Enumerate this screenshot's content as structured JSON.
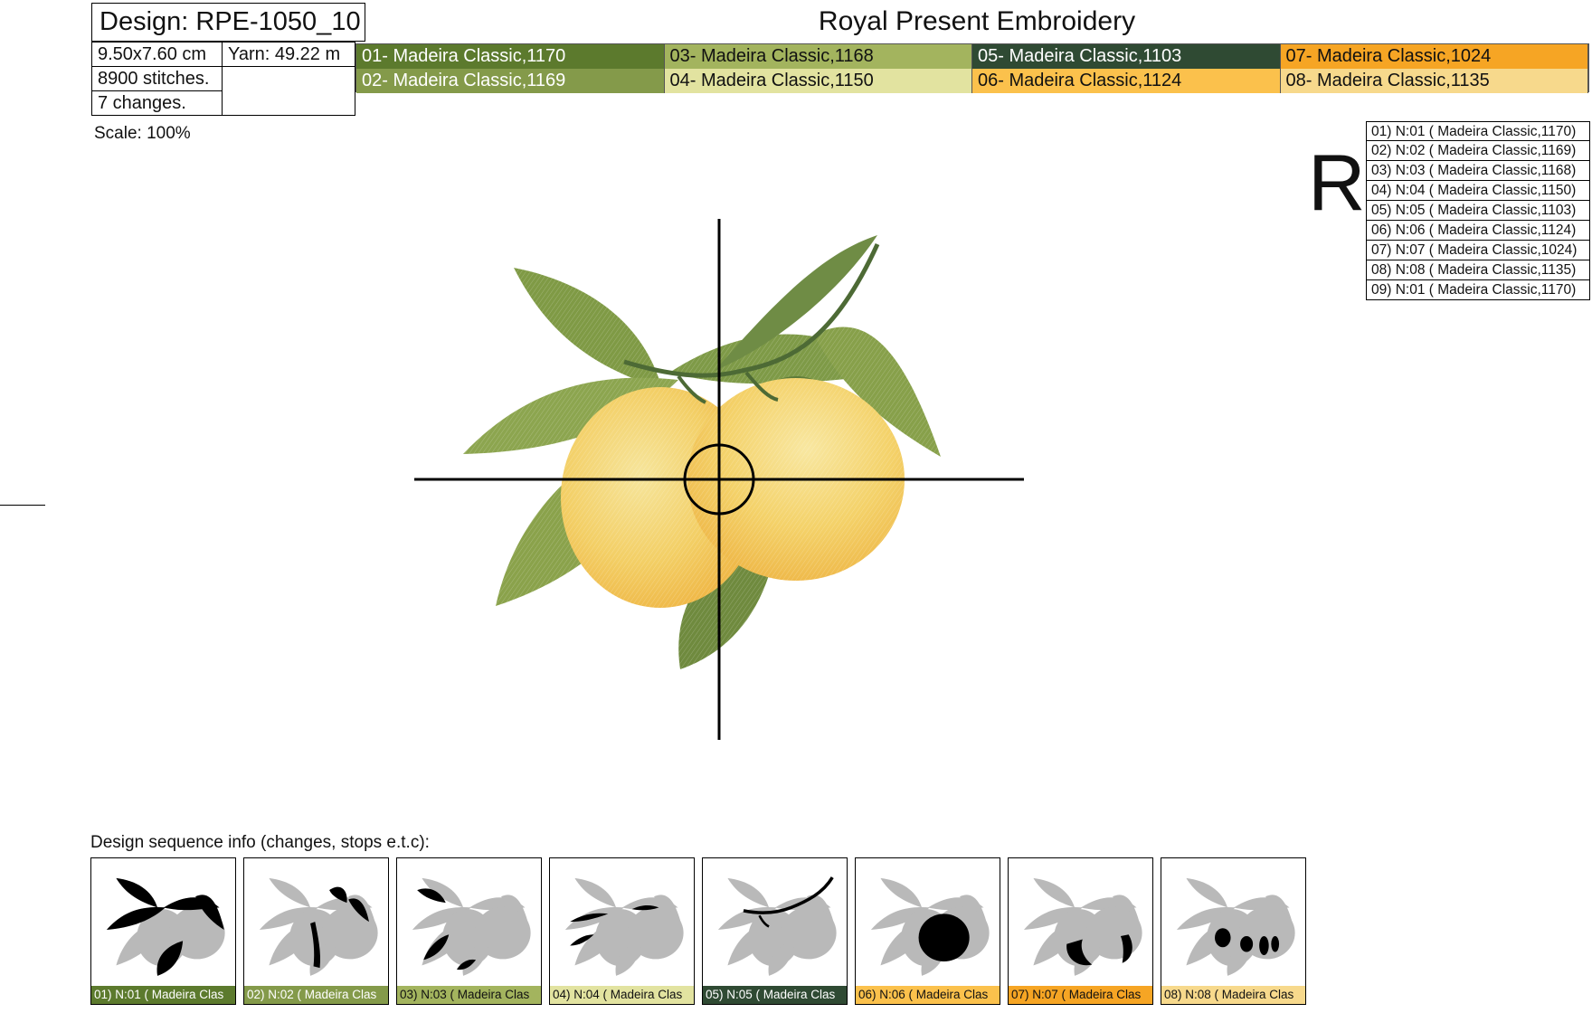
{
  "header": {
    "design_title": "Design: RPE-1050_10",
    "company": "Royal Present Embroidery"
  },
  "info": {
    "size": "9.50x7.60 cm",
    "yarn": "Yarn: 49.22 m",
    "stitches": "8900 stitches.",
    "changes": "7 changes."
  },
  "colors": [
    {
      "label": "01- Madeira Classic,1170",
      "color": "#5c7a2d",
      "dark": true
    },
    {
      "label": "02- Madeira Classic,1169",
      "color": "#849a4a",
      "dark": true
    },
    {
      "label": "03- Madeira Classic,1168",
      "color": "#a3b45e",
      "dark": false
    },
    {
      "label": "04- Madeira Classic,1150",
      "color": "#e2e3a0",
      "dark": false
    },
    {
      "label": "05- Madeira Classic,1103",
      "color": "#2f4a33",
      "dark": true
    },
    {
      "label": "06- Madeira Classic,1124",
      "color": "#fbc14c",
      "dark": false
    },
    {
      "label": "07- Madeira Classic,1024",
      "color": "#f6a524",
      "dark": false
    },
    {
      "label": "08- Madeira Classic,1135",
      "color": "#f7d98c",
      "dark": false
    }
  ],
  "scale": "Scale: 100%",
  "rotate_letter": "R",
  "thread_list": [
    "01) N:01 ( Madeira Classic,1170)",
    "02) N:02 ( Madeira Classic,1169)",
    "03) N:03 ( Madeira Classic,1168)",
    "04) N:04 ( Madeira Classic,1150)",
    "05) N:05 ( Madeira Classic,1103)",
    "06) N:06 ( Madeira Classic,1124)",
    "07) N:07 ( Madeira Classic,1024)",
    "08) N:08 ( Madeira Classic,1135)",
    "09) N:01 ( Madeira Classic,1170)"
  ],
  "sequence": {
    "label": "Design sequence info (changes, stops e.t.c):",
    "steps": [
      {
        "caption": "01) N:01 ( Madeira Clas",
        "color": "#5c7a2d",
        "dark": true,
        "highlight": "leaves_main"
      },
      {
        "caption": "02) N:02 ( Madeira Clas",
        "color": "#849a4a",
        "dark": true,
        "highlight": "leaves_right"
      },
      {
        "caption": "03) N:03 ( Madeira Clas",
        "color": "#a3b45e",
        "dark": false,
        "highlight": "leaves_left"
      },
      {
        "caption": "04) N:04 ( Madeira Clas",
        "color": "#e2e3a0",
        "dark": false,
        "highlight": "leaf_veins"
      },
      {
        "caption": "05) N:05 ( Madeira Clas",
        "color": "#2f4a33",
        "dark": true,
        "highlight": "stems"
      },
      {
        "caption": "06) N:06 ( Madeira Clas",
        "color": "#fbc14c",
        "dark": false,
        "highlight": "lemon_fill"
      },
      {
        "caption": "07) N:07 ( Madeira Clas",
        "color": "#f6a524",
        "dark": false,
        "highlight": "lemon_shade"
      },
      {
        "caption": "08) N:08 ( Madeira Clas",
        "color": "#f7d98c",
        "dark": false,
        "highlight": "lemon_spots"
      }
    ]
  }
}
